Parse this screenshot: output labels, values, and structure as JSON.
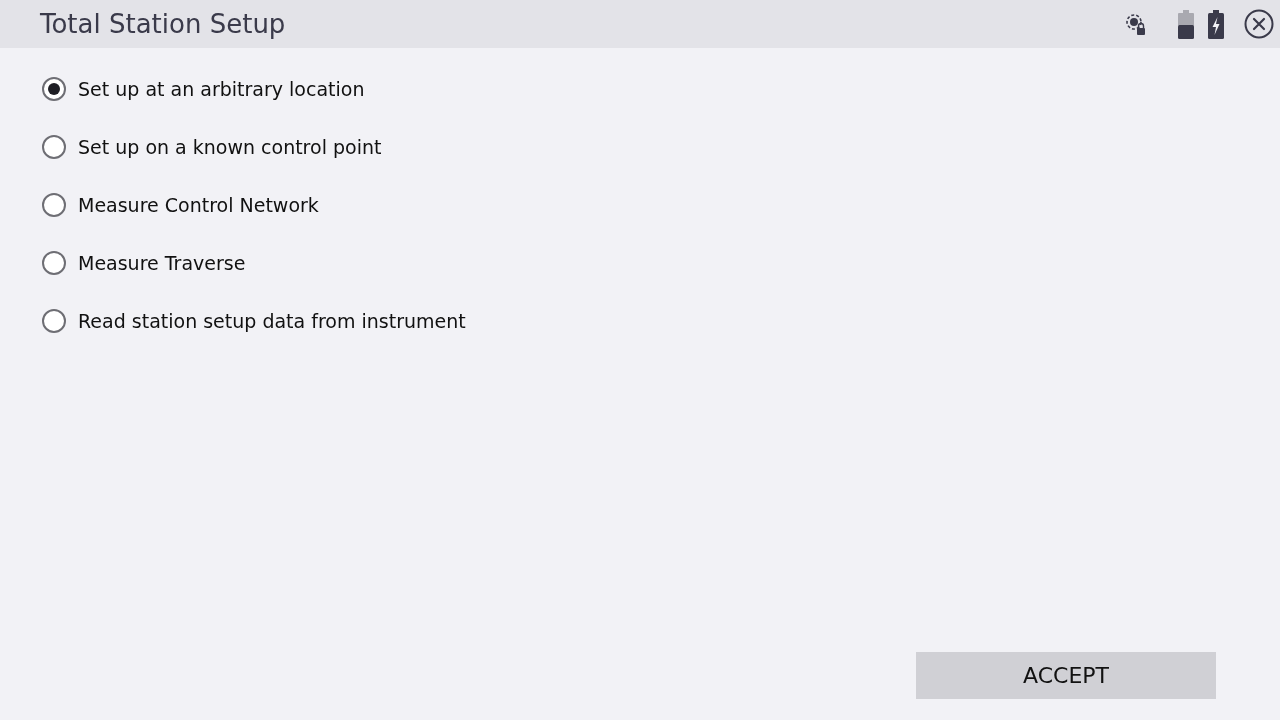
{
  "window": {
    "title": "Total Station Setup"
  },
  "options": [
    {
      "label": "Set up at an arbitrary location",
      "selected": true
    },
    {
      "label": "Set up on a known control point",
      "selected": false
    },
    {
      "label": "Measure Control Network",
      "selected": false
    },
    {
      "label": "Measure Traverse",
      "selected": false
    },
    {
      "label": "Read station setup data from instrument",
      "selected": false
    }
  ],
  "buttons": [
    "ACCEPT"
  ]
}
